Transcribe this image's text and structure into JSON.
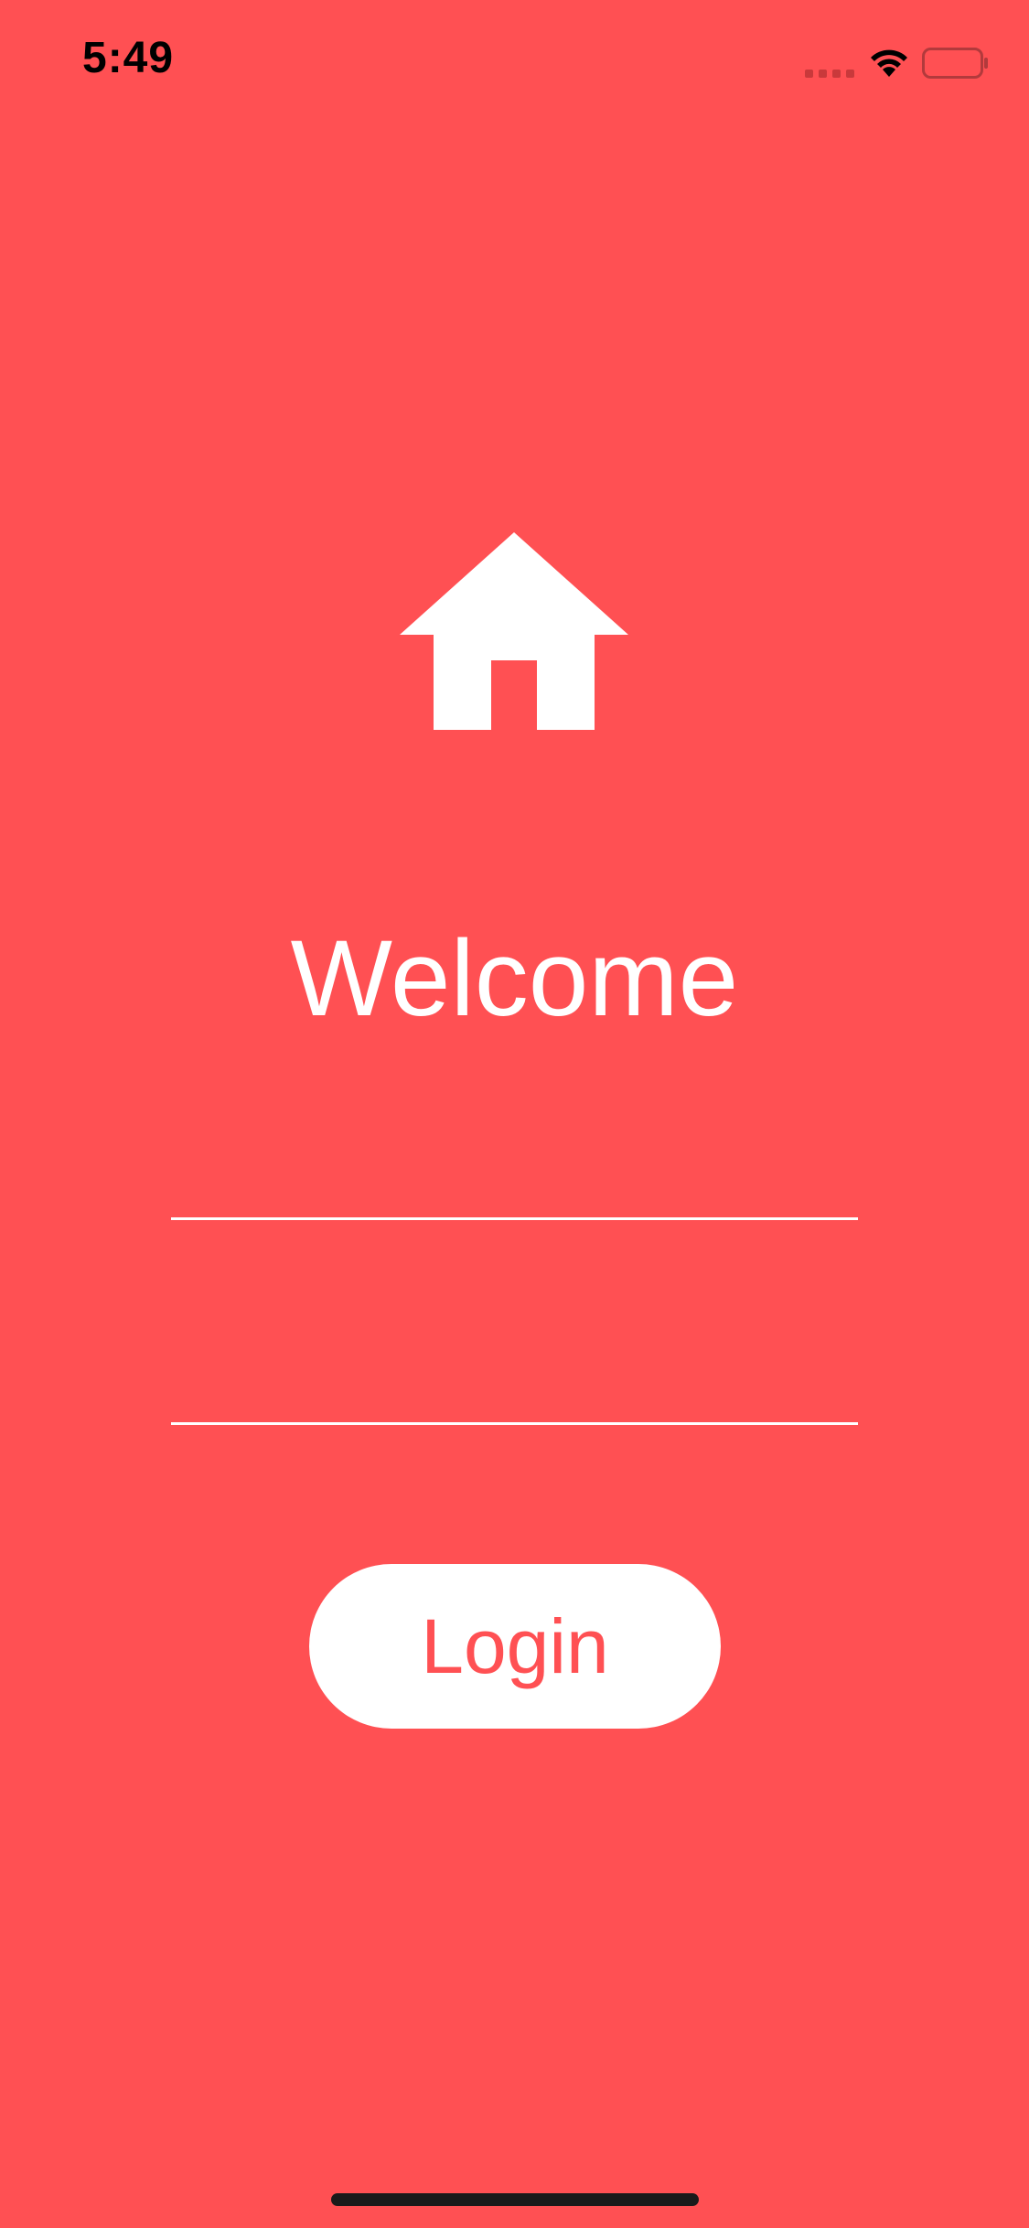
{
  "status_bar": {
    "time": "5:49",
    "icons": [
      "signal-dots-icon",
      "wifi-icon",
      "battery-icon"
    ]
  },
  "colors": {
    "background": "#FF5053",
    "text": "#FFFFFF",
    "button_background": "#FFFFFF",
    "button_text": "#FF5053"
  },
  "header": {
    "icon": "home-icon",
    "title": "Welcome"
  },
  "form": {
    "username": {
      "value": "",
      "placeholder": ""
    },
    "password": {
      "value": "",
      "placeholder": ""
    },
    "login_label": "Login"
  }
}
